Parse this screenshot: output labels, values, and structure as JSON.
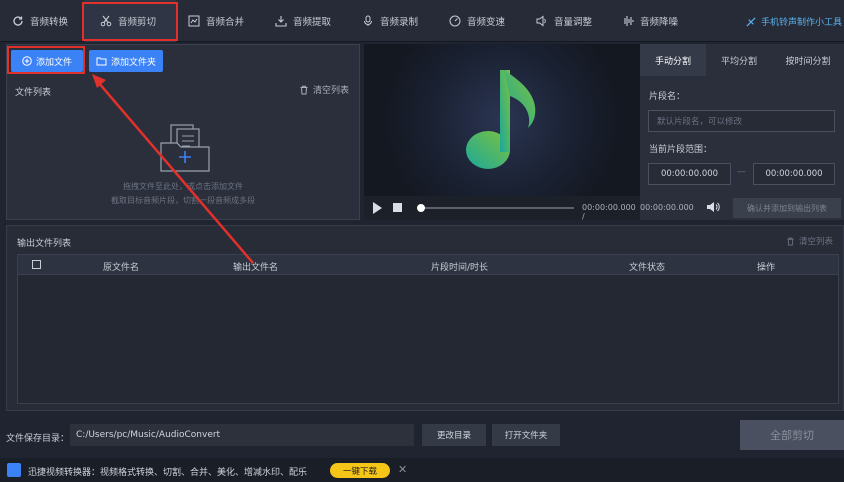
{
  "nav": {
    "tabs": [
      {
        "label": "音频转换",
        "icon": "refresh-icon"
      },
      {
        "label": "音频剪切",
        "icon": "scissors-icon"
      },
      {
        "label": "音频合并",
        "icon": "merge-icon"
      },
      {
        "label": "音频提取",
        "icon": "extract-icon"
      },
      {
        "label": "音频录制",
        "icon": "mic-icon"
      },
      {
        "label": "音频变速",
        "icon": "speed-icon"
      },
      {
        "label": "音量调整",
        "icon": "volume-icon"
      },
      {
        "label": "音频降噪",
        "icon": "waveform-icon"
      }
    ],
    "active_tab": 1,
    "right_link": "手机铃声制作小工具"
  },
  "left": {
    "add_file": "添加文件",
    "add_folder": "添加文件夹",
    "file_list": "文件列表",
    "clear_list": "清空列表",
    "hint1": "拖拽文件至此处，或点击添加文件",
    "hint2": "截取目标音频片段，切割一段音频成多段"
  },
  "player": {
    "time_current": "00:00:00.000",
    "time_separator": "/",
    "time_total": "00:00:00.000",
    "confirm_btn": "确认并添加到输出列表",
    "progress": 0
  },
  "split": {
    "tabs": [
      "手动分割",
      "平均分割",
      "按时间分割"
    ],
    "active_tab": 0,
    "segment_name_label": "片段名：",
    "segment_name_placeholder": "默认片段名，可以修改",
    "range_label": "当前片段范围：",
    "start": "00:00:00.000",
    "dash": "—",
    "end": "00:00:00.000"
  },
  "output": {
    "title": "输出文件列表",
    "clear": "清空列表",
    "columns": [
      "原文件名",
      "输出文件名",
      "片段时间/时长",
      "文件状态",
      "操作"
    ]
  },
  "save": {
    "label": "文件保存目录：",
    "path": "C:/Users/pc/Music/AudioConvert",
    "change_dir": "更改目录",
    "open_folder": "打开文件夹",
    "all_cut": "全部剪切"
  },
  "ad": {
    "text": "迅捷视频转换器：视频格式转换、切割、合并、美化、增减水印、配乐",
    "button": "一键下载",
    "close": "✕"
  },
  "colors": {
    "accent": "#3b82f6",
    "highlight_red": "#e2302a",
    "link": "#5ab4f0",
    "ad_button": "#f5c518"
  }
}
